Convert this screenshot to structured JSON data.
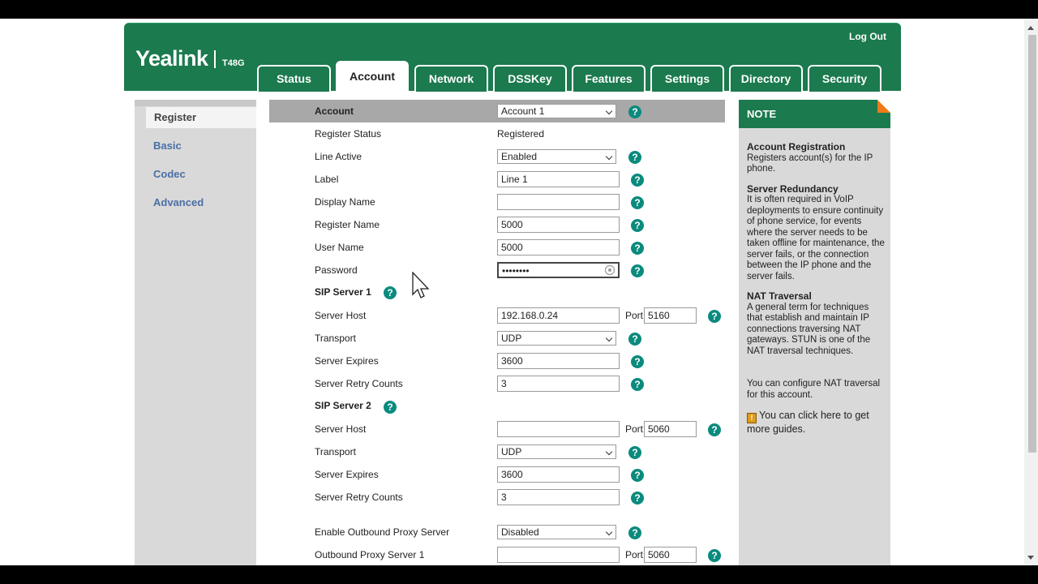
{
  "header": {
    "brand": "Yealink",
    "model": "T48G",
    "logout": "Log Out"
  },
  "tabs": [
    {
      "label": "Status"
    },
    {
      "label": "Account"
    },
    {
      "label": "Network"
    },
    {
      "label": "DSSKey"
    },
    {
      "label": "Features"
    },
    {
      "label": "Settings"
    },
    {
      "label": "Directory"
    },
    {
      "label": "Security"
    }
  ],
  "leftnav": [
    {
      "label": "Register"
    },
    {
      "label": "Basic"
    },
    {
      "label": "Codec"
    },
    {
      "label": "Advanced"
    }
  ],
  "form": {
    "account_label": "Account",
    "account_value": "Account 1",
    "register_status_label": "Register Status",
    "register_status_value": "Registered",
    "line_active_label": "Line Active",
    "line_active_value": "Enabled",
    "label_label": "Label",
    "label_value": "Line 1",
    "display_name_label": "Display Name",
    "display_name_value": "",
    "register_name_label": "Register Name",
    "register_name_value": "5000",
    "user_name_label": "User Name",
    "user_name_value": "5000",
    "password_label": "Password",
    "password_value": "••••••••",
    "sip1": {
      "title": "SIP Server 1",
      "host_label": "Server Host",
      "host_value": "192.168.0.24",
      "port_label": "Port",
      "port_value": "5160",
      "transport_label": "Transport",
      "transport_value": "UDP",
      "expires_label": "Server Expires",
      "expires_value": "3600",
      "retry_label": "Server Retry Counts",
      "retry_value": "3"
    },
    "sip2": {
      "title": "SIP Server 2",
      "host_label": "Server Host",
      "host_value": "",
      "port_label": "Port",
      "port_value": "5060",
      "transport_label": "Transport",
      "transport_value": "UDP",
      "expires_label": "Server Expires",
      "expires_value": "3600",
      "retry_label": "Server Retry Counts",
      "retry_value": "3"
    },
    "outbound_enable_label": "Enable Outbound Proxy Server",
    "outbound_enable_value": "Disabled",
    "outbound1_label": "Outbound Proxy Server 1",
    "outbound1_value": "",
    "outbound1_port_label": "Port",
    "outbound1_port_value": "5060",
    "help_glyph": "?"
  },
  "note": {
    "title": "NOTE",
    "s1_title": "Account Registration",
    "s1_text": "Registers account(s) for the IP phone.",
    "s2_title": "Server Redundancy",
    "s2_text": "It is often required in VoIP deployments to ensure continuity of phone service, for events where the server needs to be taken offline for maintenance, the server fails, or the connection between the IP phone and the server fails.",
    "s3_title": "NAT Traversal",
    "s3_text": "A general term for techniques that establish and maintain IP connections traversing NAT gateways. STUN is one of the NAT traversal techniques.",
    "s4_text": "You can configure NAT traversal for this account.",
    "guide_text": "You can click here to get more guides."
  },
  "colors": {
    "brand_green": "#1b7a4e",
    "help_teal": "#0a8b7d",
    "nav_link": "#4a6fa5",
    "note_accent": "#f07a17"
  }
}
